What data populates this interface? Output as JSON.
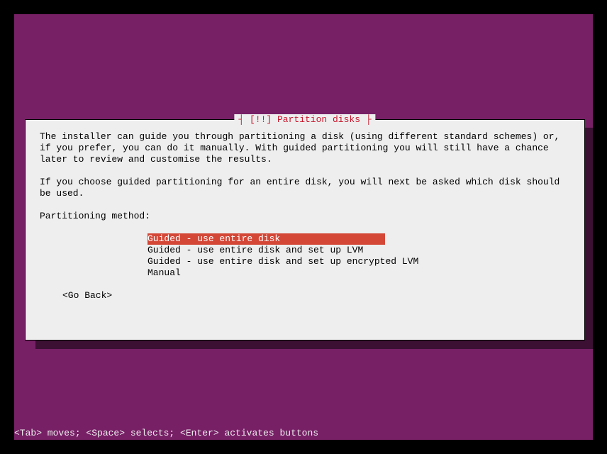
{
  "dialog": {
    "title": "[!!] Partition disks",
    "paragraph1": "The installer can guide you through partitioning a disk (using different standard schemes) or, if you prefer, you can do it manually. With guided partitioning you will still have a chance later to review and customise the results.",
    "paragraph2": "If you choose guided partitioning for an entire disk, you will next be asked which disk should be used.",
    "methodLabel": "Partitioning method:",
    "options": {
      "opt0": "Guided - use entire disk",
      "opt1": "Guided - use entire disk and set up LVM",
      "opt2": "Guided - use entire disk and set up encrypted LVM",
      "opt3": "Manual"
    },
    "goBack": "<Go Back>"
  },
  "helpBar": "<Tab> moves; <Space> selects; <Enter> activates buttons"
}
